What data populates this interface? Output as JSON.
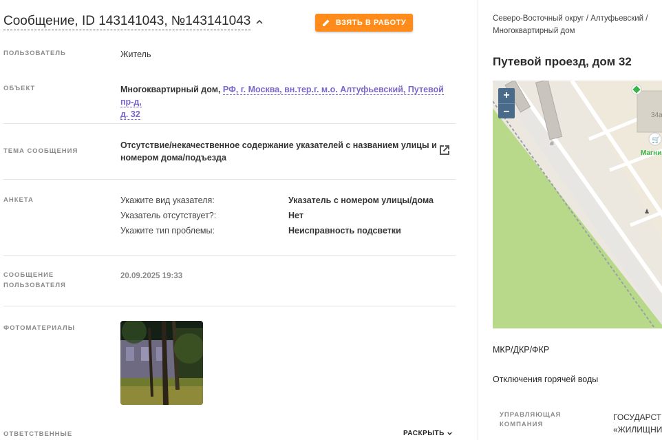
{
  "header": {
    "title": "Сообщение, ID 143141043, №143141043",
    "take_button": "ВЗЯТЬ В РАБОТУ"
  },
  "fields": {
    "user_label": "ПОЛЬЗОВАТЕЛЬ",
    "user_value": "Житель",
    "object_label": "ОБЪЕКТ",
    "object_type": "Многоквартирный дом,",
    "object_link_1": "РФ, г. Москва, вн.тер.г. м.о. Алтуфьевский, Путевой пр-д,",
    "object_link_2": "д. 32",
    "topic_label": "ТЕМА СООБЩЕНИЯ",
    "topic_line_1": "Отсутствие/некачественное содержание указателей с названием улицы и",
    "topic_line_2": "номером дома/подъезда",
    "survey_label": "АНКЕТА",
    "survey": [
      {
        "q": "Укажите вид указателя:",
        "a": "Указатель с номером улицы/дома"
      },
      {
        "q": "Указатель отсутствует?:",
        "a": "Нет"
      },
      {
        "q": "Укажите тип проблемы:",
        "a": "Неисправность подсветки"
      }
    ],
    "message_label_1": "СООБЩЕНИЕ",
    "message_label_2": "ПОЛЬЗОВАТЕЛЯ",
    "message_date": "20.09.2025 19:33",
    "photos_label": "ФОТОМАТЕРИАЛЫ",
    "responsible_label": "ОТВЕТСТВЕННЫЕ",
    "expand_label": "РАСКРЫТЬ"
  },
  "right": {
    "breadcrumb_1": "Северо-Восточный округ / Алтуфьевский /",
    "breadcrumb_2": "Многоквартирный дом",
    "address": "Путевой проезд, дом 32",
    "map": {
      "zoom_in": "+",
      "zoom_out": "–",
      "house_number": "34а",
      "shop_label": "Магни"
    },
    "item_1": "МКР/ДКР/ФКР",
    "item_2": "Отключения горячей воды",
    "mgmt_label_1": "УПРАВЛЯЮЩАЯ",
    "mgmt_label_2": "КОМПАНИЯ",
    "mgmt_value_1": "ГОСУДАРСТ",
    "mgmt_value_2": "«ЖИЛИЩНИ"
  },
  "colors": {
    "accent_orange": "#ff8c1a",
    "link_purple": "#7b66c9",
    "map_green": "#b9d98a",
    "zoom_blue": "#4a6a8a"
  }
}
